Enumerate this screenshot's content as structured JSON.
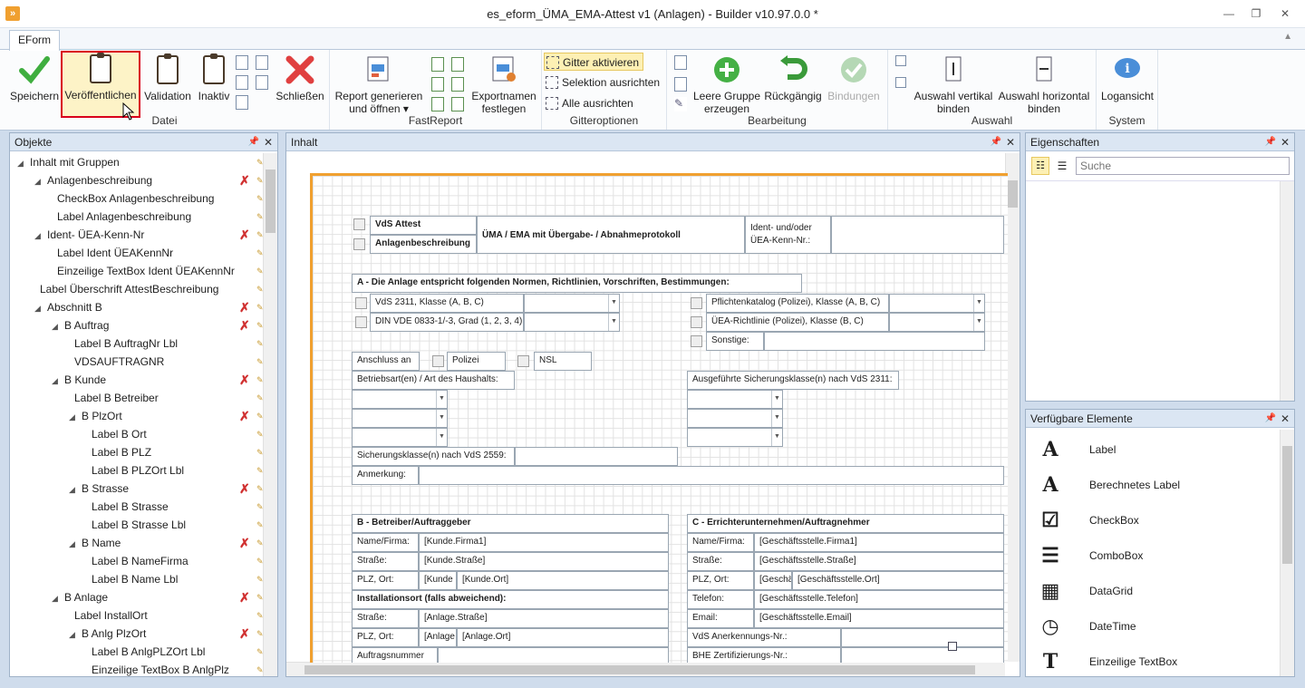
{
  "window": {
    "title": "es_eform_ÜMA_EMA-Attest v1 (Anlagen) - Builder v10.97.0.0 *"
  },
  "ribbon_tab": "EForm",
  "ribbon": {
    "datei": {
      "label": "Datei",
      "speichern": "Speichern",
      "veroeffentlichen": "Veröffentlichen",
      "validation": "Validation",
      "inaktiv": "Inaktiv",
      "schliessen": "Schließen"
    },
    "fastreport": {
      "label": "FastReport",
      "report_line1": "Report generieren",
      "report_line2": "und öffnen",
      "export_line1": "Exportnamen",
      "export_line2": "festlegen"
    },
    "gitter": {
      "label": "Gitteroptionen",
      "aktivieren": "Gitter aktivieren",
      "selektion": "Selektion ausrichten",
      "alle": "Alle ausrichten"
    },
    "bearbeitung": {
      "label": "Bearbeitung",
      "leere_line1": "Leere Gruppe",
      "leere_line2": "erzeugen",
      "rueck": "Rückgängig",
      "bindungen": "Bindungen"
    },
    "auswahl": {
      "label": "Auswahl",
      "vert_line1": "Auswahl vertikal",
      "vert_line2": "binden",
      "hor_line1": "Auswahl horizontal",
      "hor_line2": "binden"
    },
    "system": {
      "label": "System",
      "log": "Logansicht"
    }
  },
  "objekte": {
    "title": "Objekte",
    "items": [
      {
        "label": "Inhalt mit Gruppen",
        "level": 0,
        "arrow": true,
        "del": false
      },
      {
        "label": "Anlagenbeschreibung",
        "level": 1,
        "arrow": true,
        "del": true
      },
      {
        "label": "CheckBox Anlagenbeschreibung",
        "level": 2,
        "arrow": false,
        "del": false
      },
      {
        "label": "Label Anlagenbeschreibung",
        "level": 2,
        "arrow": false,
        "del": false
      },
      {
        "label": "Ident- ÜEA-Kenn-Nr",
        "level": 1,
        "arrow": true,
        "del": true
      },
      {
        "label": "Label Ident ÜEAKennNr",
        "level": 2,
        "arrow": false,
        "del": false
      },
      {
        "label": "Einzeilige TextBox Ident ÜEAKennNr",
        "level": 2,
        "arrow": false,
        "del": false
      },
      {
        "label": "Label Überschrift AttestBeschreibung",
        "level": 1,
        "arrow": false,
        "del": false
      },
      {
        "label": "Abschnitt B",
        "level": 1,
        "arrow": true,
        "del": true
      },
      {
        "label": "B Auftrag",
        "level": 2,
        "arrow": true,
        "del": true
      },
      {
        "label": "Label B AuftragNr Lbl",
        "level": 3,
        "arrow": false,
        "del": false
      },
      {
        "label": "VDSAUFTRAGNR",
        "level": 3,
        "arrow": false,
        "del": false
      },
      {
        "label": "B Kunde",
        "level": 2,
        "arrow": true,
        "del": true
      },
      {
        "label": "Label B Betreiber",
        "level": 3,
        "arrow": false,
        "del": false
      },
      {
        "label": "B PlzOrt",
        "level": 3,
        "arrow": true,
        "del": true
      },
      {
        "label": "Label B Ort",
        "level": 4,
        "arrow": false,
        "del": false
      },
      {
        "label": "Label B PLZ",
        "level": 4,
        "arrow": false,
        "del": false
      },
      {
        "label": "Label B PLZOrt Lbl",
        "level": 4,
        "arrow": false,
        "del": false
      },
      {
        "label": "B Strasse",
        "level": 3,
        "arrow": true,
        "del": true
      },
      {
        "label": "Label B Strasse",
        "level": 4,
        "arrow": false,
        "del": false
      },
      {
        "label": "Label B Strasse Lbl",
        "level": 4,
        "arrow": false,
        "del": false
      },
      {
        "label": "B Name",
        "level": 3,
        "arrow": true,
        "del": true
      },
      {
        "label": "Label B NameFirma",
        "level": 4,
        "arrow": false,
        "del": false
      },
      {
        "label": "Label B Name Lbl",
        "level": 4,
        "arrow": false,
        "del": false
      },
      {
        "label": "B Anlage",
        "level": 2,
        "arrow": true,
        "del": true
      },
      {
        "label": "Label InstallOrt",
        "level": 3,
        "arrow": false,
        "del": false
      },
      {
        "label": "B Anlg PlzOrt",
        "level": 3,
        "arrow": true,
        "del": true
      },
      {
        "label": "Label B AnlgPLZOrt Lbl",
        "level": 4,
        "arrow": false,
        "del": false
      },
      {
        "label": "Einzeilige TextBox B AnlgPlz",
        "level": 4,
        "arrow": false,
        "del": false
      }
    ]
  },
  "inhalt": {
    "title": "Inhalt"
  },
  "form": {
    "vds_attest": "VdS Attest",
    "anlagenbeschreibung": "Anlagenbeschreibung",
    "uema_title": "ÜMA / EMA mit Übergabe- / Abnahmeprotokoll",
    "ident_line1": "Ident- und/oder",
    "ident_line2": "ÜEA-Kenn-Nr.:",
    "section_a": "A - Die Anlage entspricht folgenden Normen, Richtlinien, Vorschriften, Bestimmungen:",
    "vds2311": "VdS 2311, Klasse (A, B, C)",
    "din_vde": "DIN VDE 0833-1/-3, Grad (1, 2, 3, 4)",
    "pflichtenkatalog": "Pflichtenkatalog (Polizei), Klasse (A, B, C)",
    "uea_richtlinie": "ÜEA-Richtlinie (Polizei), Klasse (B, C)",
    "sonstige": "Sonstige:",
    "anschluss": "Anschluss an",
    "polizei": "Polizei",
    "nsl": "NSL",
    "betriebsart": "Betriebsart(en) / Art des Haushalts:",
    "sicherungsklasse2311": "Ausgeführte Sicherungsklasse(n) nach VdS 2311:",
    "sicherungsklasse2559": "Sicherungsklasse(n) nach VdS 2559:",
    "anmerkung": "Anmerkung:",
    "section_b": "B - Betreiber/Auftraggeber",
    "section_c": "C - Errichterunternehmen/Auftragnehmer",
    "name_firma": "Name/Firma:",
    "strasse": "Straße:",
    "plz_ort": "PLZ, Ort:",
    "telefon": "Telefon:",
    "email": "Email:",
    "kunde_firma": "[Kunde.Firma1]",
    "kunde_strasse": "[Kunde.Straße]",
    "kunde_plz": "[Kunde",
    "kunde_ort": "[Kunde.Ort]",
    "installationsort": "Installationsort (falls abweichend):",
    "anlage_strasse": "[Anlage.Straße]",
    "anlage_plz": "[Anlage",
    "anlage_ort": "[Anlage.Ort]",
    "auftragsnummer": "Auftragsnummer",
    "gs_firma": "[Geschäftsstelle.Firma1]",
    "gs_strasse": "[Geschäftsstelle.Straße]",
    "gs_plz": "[Geschä",
    "gs_ort": "[Geschäftsstelle.Ort]",
    "gs_telefon": "[Geschäftsstelle.Telefon]",
    "gs_email": "[Geschäftsstelle.Email]",
    "vds_anerkennung": "VdS Anerkennungs-Nr.:",
    "bhe": "BHE Zertifizierungs-Nr.:"
  },
  "eigenschaften": {
    "title": "Eigenschaften",
    "search_placeholder": "Suche"
  },
  "verfuegbar": {
    "title": "Verfügbare Elemente",
    "items": [
      {
        "label": "Label",
        "icon": "label-icon",
        "glyph": "A"
      },
      {
        "label": "Berechnetes Label",
        "icon": "calculated-label-icon",
        "glyph": "A"
      },
      {
        "label": "CheckBox",
        "icon": "checkbox-icon",
        "glyph": "☑"
      },
      {
        "label": "ComboBox",
        "icon": "combobox-icon",
        "glyph": "☰"
      },
      {
        "label": "DataGrid",
        "icon": "datagrid-icon",
        "glyph": "▦"
      },
      {
        "label": "DateTime",
        "icon": "datetime-icon",
        "glyph": "◷"
      },
      {
        "label": "Einzeilige TextBox",
        "icon": "textbox-icon",
        "glyph": "T"
      }
    ]
  },
  "colors": {
    "accent": "#f0a030",
    "ribbon_highlight": "#d9001b",
    "panel_header": "#dbe6f3"
  }
}
